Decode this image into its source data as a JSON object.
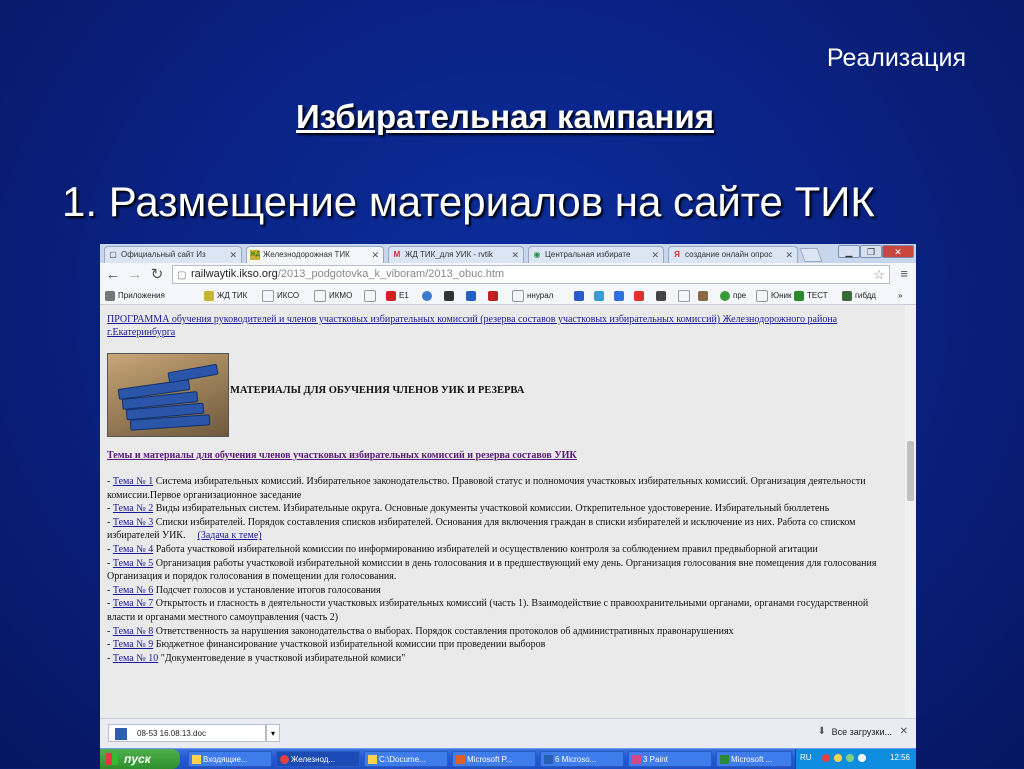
{
  "slide": {
    "subtitle": "Реализация",
    "title": "Избирательная кампания",
    "heading": "1. Размещение материалов на сайте ТИК"
  },
  "browser": {
    "tabs": [
      {
        "label": "Официальный сайт Из",
        "icon": "page-icon",
        "active": false
      },
      {
        "label": "Железнодорожная ТИК",
        "icon": "zhd-tik-icon",
        "active": true
      },
      {
        "label": "ЖД ТИК_для УИК - rvtik",
        "icon": "gmail-icon",
        "active": false
      },
      {
        "label": "Центральная избирате",
        "icon": "globe-icon",
        "active": false
      },
      {
        "label": "создание онлайн опрос",
        "icon": "yandex-icon",
        "active": false
      }
    ],
    "url_domain": "railwaytik.ikso.org",
    "url_path": "/2013_podgotovka_k_viboram/2013_obuc.htm",
    "bookmarks": [
      {
        "label": "Приложения",
        "icon": "apps-icon",
        "color": "#666666"
      },
      {
        "label": "ЖД ТИК",
        "icon": "zhd-tik-icon",
        "color": "#c9b23a"
      },
      {
        "label": "ИКСО",
        "icon": "page-icon",
        "color": "#ffffff"
      },
      {
        "label": "ИКМО",
        "icon": "page-icon",
        "color": "#ffffff"
      },
      {
        "label": "",
        "icon": "page-icon",
        "color": "#ffffff"
      },
      {
        "label": "E1",
        "icon": "e1-icon",
        "color": "#d02020"
      },
      {
        "label": "",
        "icon": "globe-icon",
        "color": "#3a7ad0"
      },
      {
        "label": "",
        "icon": "u-icon",
        "color": "#333333"
      },
      {
        "label": "",
        "icon": "rbc-icon",
        "color": "#2060c0"
      },
      {
        "label": "",
        "icon": "66-icon",
        "color": "#c02020"
      },
      {
        "label": "ннурал",
        "icon": "page-icon",
        "color": "#ffffff"
      },
      {
        "label": "",
        "icon": "mail-icon",
        "color": "#2a5ad0"
      },
      {
        "label": "",
        "icon": "weather-icon",
        "color": "#3a9ad0"
      },
      {
        "label": "",
        "icon": "google-icon",
        "color": "#3070e0"
      },
      {
        "label": "",
        "icon": "yandex-icon",
        "color": "#e03030"
      },
      {
        "label": "",
        "icon": "text-icon",
        "color": "#444444"
      },
      {
        "label": "",
        "icon": "page-icon",
        "color": "#ffffff"
      },
      {
        "label": "",
        "icon": "photo-icon",
        "color": "#8a6a40"
      },
      {
        "label": "пре",
        "icon": "leaf-icon",
        "color": "#3a9a3a"
      },
      {
        "label": "Юник",
        "icon": "page-icon",
        "color": "#ffffff"
      },
      {
        "label": "ТЕСТ",
        "icon": "test-icon",
        "color": "#2a8a2a"
      },
      {
        "label": "гибдд",
        "icon": "gibdd-icon",
        "color": "#3a6a3a"
      }
    ],
    "bookmarks_overflow": "»"
  },
  "page": {
    "program_link": "ПРОГРАММА обучения руководителей и членов участковых избирательных комиссий (резерва составов участковых избирательных комиссий) Железнодорожного района г.Екатеринбурга",
    "materials_title": "МАТЕРИАЛЫ ДЛЯ ОБУЧЕНИЯ ЧЛЕНОВ УИК И РЕЗЕРВА",
    "themes_heading": "Темы и материалы для обучения членов участковых избирательных комиссий и резерва составов УИК",
    "items": [
      {
        "link": "Тема № 1",
        "text": "Система избирательных комиссий. Избирательное законодательство. Правовой статус и полномочия участковых избирательных комиссий. Организация деятельности комиссии.Первое организационное заседание"
      },
      {
        "link": "Тема № 2",
        "text": "Виды избирательных систем. Избирательные округа. Основные документы участковой комиссии. Открепительное удостоверение. Избирательный бюллетень"
      },
      {
        "link": "Тема № 3",
        "text": "Списки избирателей. Порядок составления списков избирателей. Основания для включения граждан в списки избирателей и исключение из них. Работа со списком избирателей УИК.",
        "extra_link": "(Задача к теме)"
      },
      {
        "link": "Тема № 4",
        "text": "Работа участковой избирательной комиссии по информированию избирателей и осуществлению контроля за соблюдением правил предвыборной агитации"
      },
      {
        "link": "Тема № 5",
        "text": "Организация работы участковой избирательной комиссии в день голосования и в предшествующий ему день. Организация голосования вне помещения для голосования Организация и порядок голосования в помещении для голосования."
      },
      {
        "link": "Тема № 6",
        "text": "Подсчет голосов и установление итогов голосования"
      },
      {
        "link": "Тема № 7",
        "text": "Открытость и гласность в деятельности участковых избирательных комиссий (часть 1). Взаимодействие с правоохранительными органами, органами государственной власти и органами местного самоуправления (часть 2)"
      },
      {
        "link": "Тема № 8",
        "text": "Ответственность за нарушения законодательства о выборах. Порядок составления протоколов об административных правонарушениях"
      },
      {
        "link": "Тема № 9",
        "text": "Бюджетное финансирование участковой избирательной комиссии при проведении выборов"
      },
      {
        "link": "Тема № 10",
        "text": "\"Документоведение в участковой избирательной комиси\""
      }
    ]
  },
  "downloads": {
    "file": "08-53 16.08.13.doc",
    "all_label": "Все загрузки..."
  },
  "taskbar": {
    "start_label": "пуск",
    "tasks": [
      {
        "label": "Входящие...",
        "icon": "outlook-icon"
      },
      {
        "label": "Железнод...",
        "icon": "chrome-icon",
        "active": true
      },
      {
        "label": "C:\\Docume...",
        "icon": "folder-icon"
      },
      {
        "label": "Microsoft P...",
        "icon": "powerpoint-icon"
      },
      {
        "label": "6 Microso...",
        "icon": "word-icon"
      },
      {
        "label": "3 Paint",
        "icon": "paint-icon"
      },
      {
        "label": "Microsoft ...",
        "icon": "excel-icon"
      }
    ],
    "lang": "RU",
    "clock": "12:56"
  }
}
